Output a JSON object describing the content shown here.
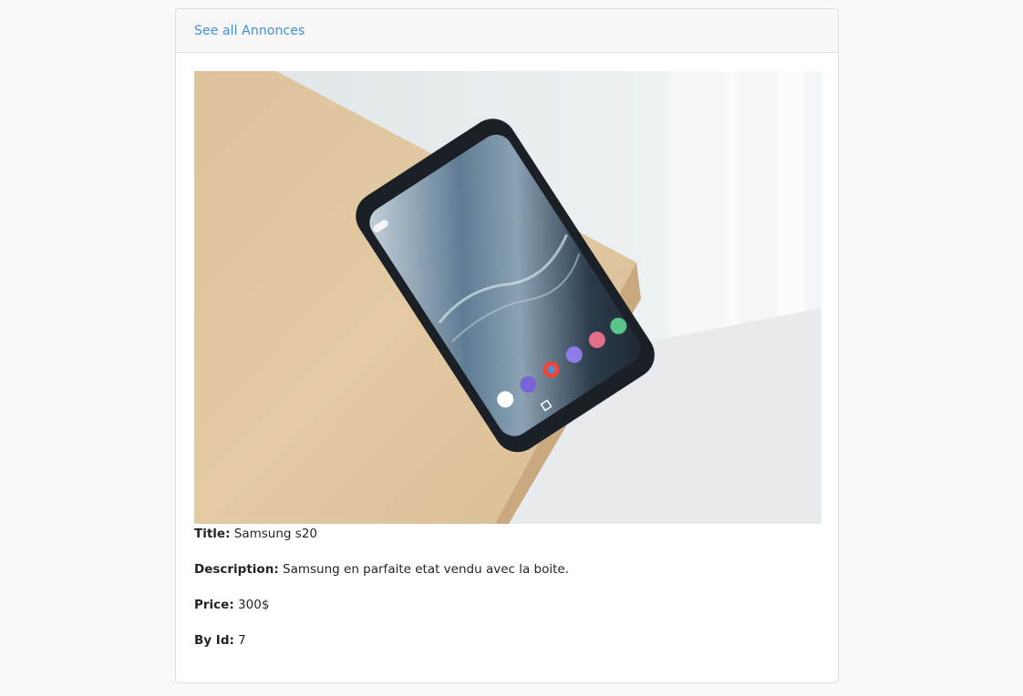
{
  "header": {
    "link_label": "See all Annonces"
  },
  "image": {
    "alt": "Samsung phone on wooden table"
  },
  "details": {
    "title_label": "Title:",
    "title_value": "Samsung s20",
    "description_label": "Description:",
    "description_value": "Samsung en parfaite etat vendu avec la boite.",
    "price_label": "Price:",
    "price_value": "300$",
    "byid_label": "By Id:",
    "byid_value": "7"
  },
  "colors": {
    "link": "#3f8fd6",
    "header_bg": "#f7f7f7",
    "page_bg": "#f8f9fb"
  }
}
